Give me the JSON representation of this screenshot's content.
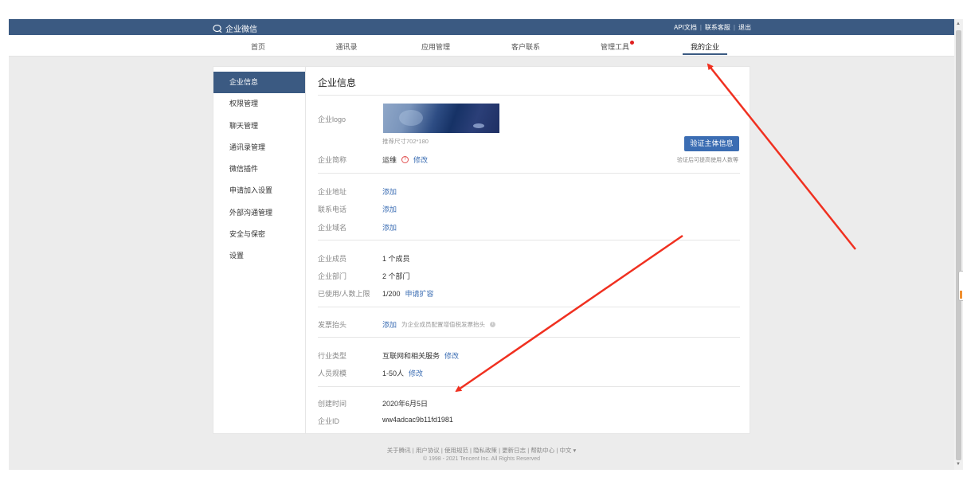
{
  "topbar": {
    "brand": "企业微信",
    "links": [
      "API文档",
      "联系客服",
      "退出"
    ]
  },
  "nav": {
    "items": [
      "首页",
      "通讯录",
      "应用管理",
      "客户联系",
      "管理工具",
      "我的企业"
    ],
    "active": "我的企业"
  },
  "sidebar": {
    "items": [
      "企业信息",
      "权限管理",
      "聊天管理",
      "通讯录管理",
      "微信插件",
      "申请加入设置",
      "外部沟通管理",
      "安全与保密",
      "设置"
    ],
    "active": "企业信息"
  },
  "content": {
    "title": "企业信息",
    "logo_label": "企业logo",
    "logo_hint": "推荐尺寸702*180",
    "verify_button": "验证主体信息",
    "verify_hint": "验证后可提高使用人数等",
    "short_name_label": "企业简称",
    "short_name_value": "运维",
    "edit": "修改",
    "address_label": "企业地址",
    "phone_label": "联系电话",
    "domain_label": "企业域名",
    "add": "添加",
    "members_label": "企业成员",
    "members_value": "1 个成员",
    "departments_label": "企业部门",
    "departments_value": "2 个部门",
    "usage_label": "已使用/人数上限",
    "usage_value": "1/200",
    "expand": "申请扩容",
    "invoice_label": "发票抬头",
    "invoice_hint": "为企业成员配置增值税发票抬头",
    "industry_label": "行业类型",
    "industry_value": "互联网和相关服务",
    "scale_label": "人员规模",
    "scale_value": "1-50人",
    "created_label": "创建时间",
    "created_value": "2020年6月5日",
    "corp_id_label": "企业ID",
    "corp_id_value": "ww4adcac9b11fd1981"
  },
  "footer": {
    "links": [
      "关于腾讯",
      "用户协议",
      "使用规范",
      "隐私政策",
      "更新日志",
      "帮助中心",
      "中文 ▾"
    ],
    "copyright": "© 1998 - 2021 Tencent Inc. All Rights Reserved"
  },
  "colors": {
    "brand_blue": "#3b5a82",
    "link_blue": "#3b6db3",
    "annotation_red": "#f03020"
  }
}
